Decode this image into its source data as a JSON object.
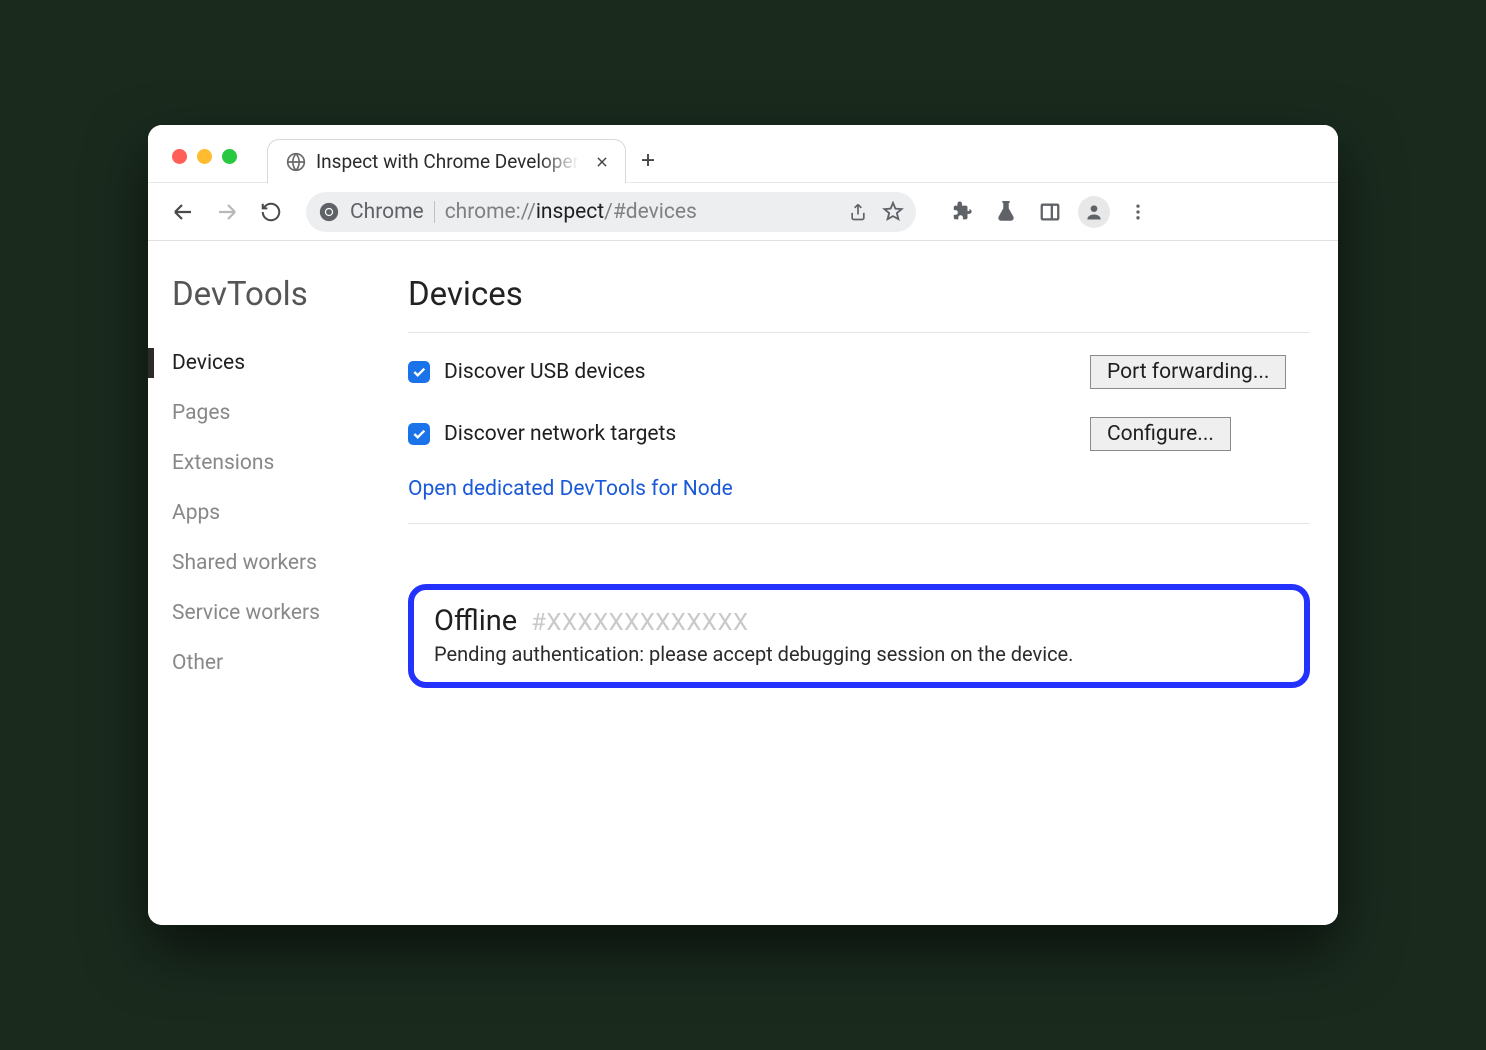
{
  "tab": {
    "title": "Inspect with Chrome Developer"
  },
  "omnibox": {
    "origin_label": "Chrome",
    "url_prefix": "chrome://",
    "url_path": "inspect",
    "url_hash": "/#devices"
  },
  "sidebar": {
    "title": "DevTools",
    "items": [
      {
        "label": "Devices",
        "active": true
      },
      {
        "label": "Pages",
        "active": false
      },
      {
        "label": "Extensions",
        "active": false
      },
      {
        "label": "Apps",
        "active": false
      },
      {
        "label": "Shared workers",
        "active": false
      },
      {
        "label": "Service workers",
        "active": false
      },
      {
        "label": "Other",
        "active": false
      }
    ]
  },
  "main": {
    "title": "Devices",
    "discover_usb_label": "Discover USB devices",
    "port_forwarding_label": "Port forwarding...",
    "discover_network_label": "Discover network targets",
    "configure_label": "Configure...",
    "node_link": "Open dedicated DevTools for Node"
  },
  "device": {
    "status": "Offline",
    "id": "#XXXXXXXXXXXXX",
    "message": "Pending authentication: please accept debugging session on the device."
  }
}
